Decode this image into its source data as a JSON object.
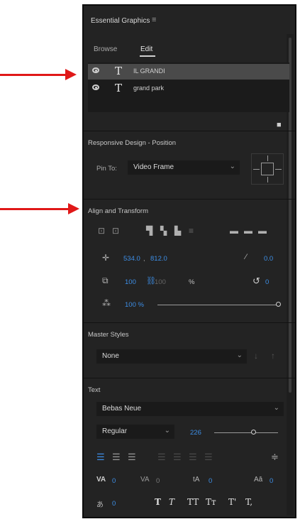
{
  "panel": {
    "title": "Essential Graphics"
  },
  "tabs": [
    {
      "label": "Browse"
    },
    {
      "label": "Edit"
    }
  ],
  "layers": [
    {
      "name": "IL GRANDI"
    },
    {
      "name": "grand park"
    }
  ],
  "responsive": {
    "title": "Responsive Design - Position",
    "pin_label": "Pin To:",
    "pin_value": "Video Frame"
  },
  "align": {
    "title": "Align and Transform",
    "pos_x": "534.0",
    "pos_y": "812.0",
    "anchor": "0.0",
    "scale_w": "100",
    "scale_h": "100",
    "scale_unit": "%",
    "rotation": "0",
    "opacity": "100 %"
  },
  "master": {
    "title": "Master Styles",
    "value": "None"
  },
  "text": {
    "title": "Text",
    "font": "Bebas Neue",
    "style": "Regular",
    "size": "226",
    "kerning": "0",
    "tracking": "0",
    "leading": "0",
    "baseline": "0",
    "tsume": "0",
    "format_buttons": [
      "T",
      "T",
      "TT",
      "Tт",
      "T'",
      "T,"
    ]
  },
  "colors": {
    "accent": "#3d8ee6",
    "annotation_arrow": "#e01818"
  }
}
